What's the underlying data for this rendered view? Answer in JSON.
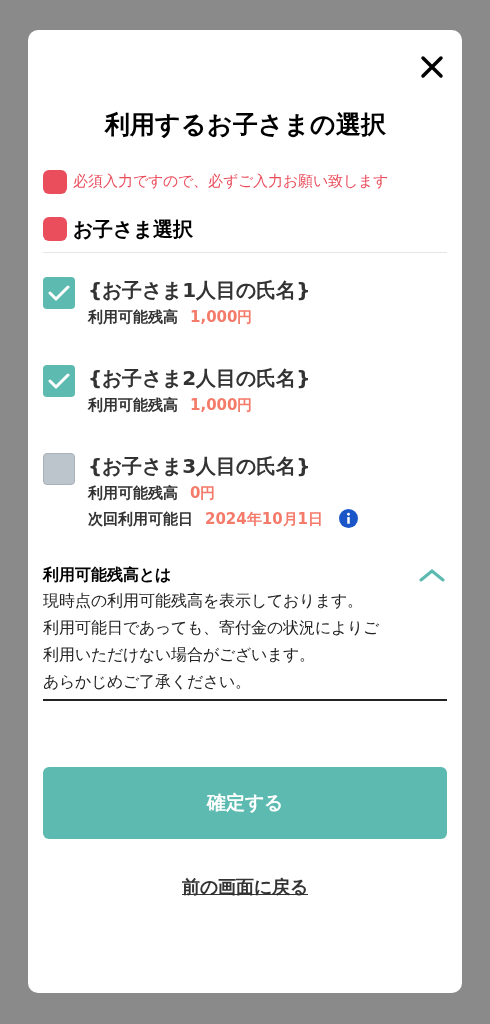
{
  "dialog": {
    "title": "利用するお子さまの選択",
    "required_note": "必須入力ですので、必ずご入力お願い致します",
    "section_title": "お子さま選択"
  },
  "children": [
    {
      "name": "{お子さま1人目の氏名}",
      "checked": true,
      "balance_label": "利用可能残高",
      "balance": "1,000円"
    },
    {
      "name": "{お子さま2人目の氏名}",
      "checked": true,
      "balance_label": "利用可能残高",
      "balance": "1,000円"
    },
    {
      "name": "{お子さま3人目の氏名}",
      "checked": false,
      "balance_label": "利用可能残高",
      "balance": "0円",
      "next_date_label": "次回利用可能日",
      "next_date": "2024年10月1日"
    }
  ],
  "explainer": {
    "title": "利用可能残高とは",
    "expanded": true,
    "lines": [
      "現時点の利用可能残高を表示しております。",
      "利用可能日であっても、寄付金の状況によりご",
      "利用いただけない場合がございます。",
      "あらかじめご了承ください。"
    ]
  },
  "confirm_button": "確定する",
  "back_link": "前の画面に戻る"
}
